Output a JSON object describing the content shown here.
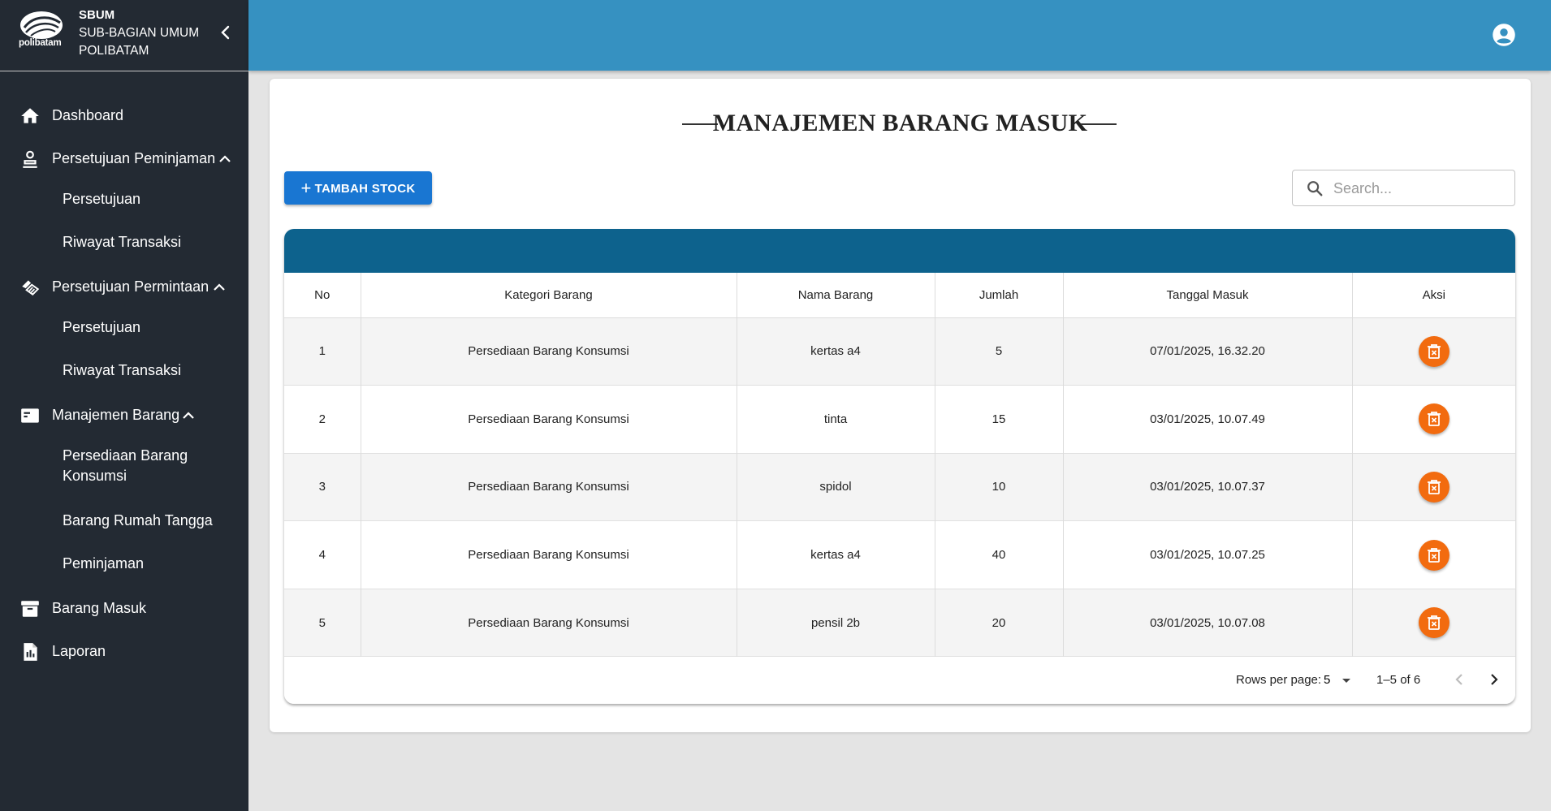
{
  "brand": {
    "logo_text": "polibatam",
    "line1": "SBUM",
    "line2": "SUB-BAGIAN UMUM",
    "line3": "POLIBATAM"
  },
  "sidebar": {
    "items": [
      {
        "label": "Dashboard",
        "icon": "home-icon"
      },
      {
        "label": "Persetujuan Peminjaman",
        "icon": "person-icon",
        "expanded": true,
        "children": [
          {
            "label": "Persetujuan"
          },
          {
            "label": "Riwayat Transaksi"
          }
        ]
      },
      {
        "label": "Persetujuan Permintaan",
        "icon": "handshake-icon",
        "expanded": true,
        "children": [
          {
            "label": "Persetujuan"
          },
          {
            "label": "Riwayat Transaksi"
          }
        ]
      },
      {
        "label": "Manajemen Barang",
        "icon": "card-icon",
        "expanded": true,
        "children": [
          {
            "label": "Persediaan Barang Konsumsi"
          },
          {
            "label": "Barang Rumah Tangga"
          },
          {
            "label": "Peminjaman"
          }
        ]
      },
      {
        "label": "Barang Masuk",
        "icon": "archive-icon"
      },
      {
        "label": "Laporan",
        "icon": "report-icon"
      }
    ]
  },
  "main": {
    "title": "MANAJEMEN BARANG MASUK",
    "add_button": "TAMBAH STOCK",
    "search_placeholder": "Search..."
  },
  "table": {
    "columns": [
      "No",
      "Kategori Barang",
      "Nama Barang",
      "Jumlah",
      "Tanggal Masuk",
      "Aksi"
    ],
    "rows": [
      {
        "no": "1",
        "kategori": "Persediaan Barang Konsumsi",
        "nama": "kertas a4",
        "jumlah": "5",
        "tanggal": "07/01/2025, 16.32.20"
      },
      {
        "no": "2",
        "kategori": "Persediaan Barang Konsumsi",
        "nama": "tinta",
        "jumlah": "15",
        "tanggal": "03/01/2025, 10.07.49"
      },
      {
        "no": "3",
        "kategori": "Persediaan Barang Konsumsi",
        "nama": "spidol",
        "jumlah": "10",
        "tanggal": "03/01/2025, 10.07.37"
      },
      {
        "no": "4",
        "kategori": "Persediaan Barang Konsumsi",
        "nama": "kertas a4",
        "jumlah": "40",
        "tanggal": "03/01/2025, 10.07.25"
      },
      {
        "no": "5",
        "kategori": "Persediaan Barang Konsumsi",
        "nama": "pensil 2b",
        "jumlah": "20",
        "tanggal": "03/01/2025, 10.07.08"
      }
    ]
  },
  "pagination": {
    "rows_per_page_label": "Rows per page:",
    "rows_per_page": "5",
    "range": "1–5 of 6"
  },
  "colors": {
    "sidebar_bg": "#232a33",
    "topbar": "#3691c1",
    "table_header": "#0d628d",
    "primary_button": "#1976d2",
    "delete_button": "#f26b0f"
  }
}
